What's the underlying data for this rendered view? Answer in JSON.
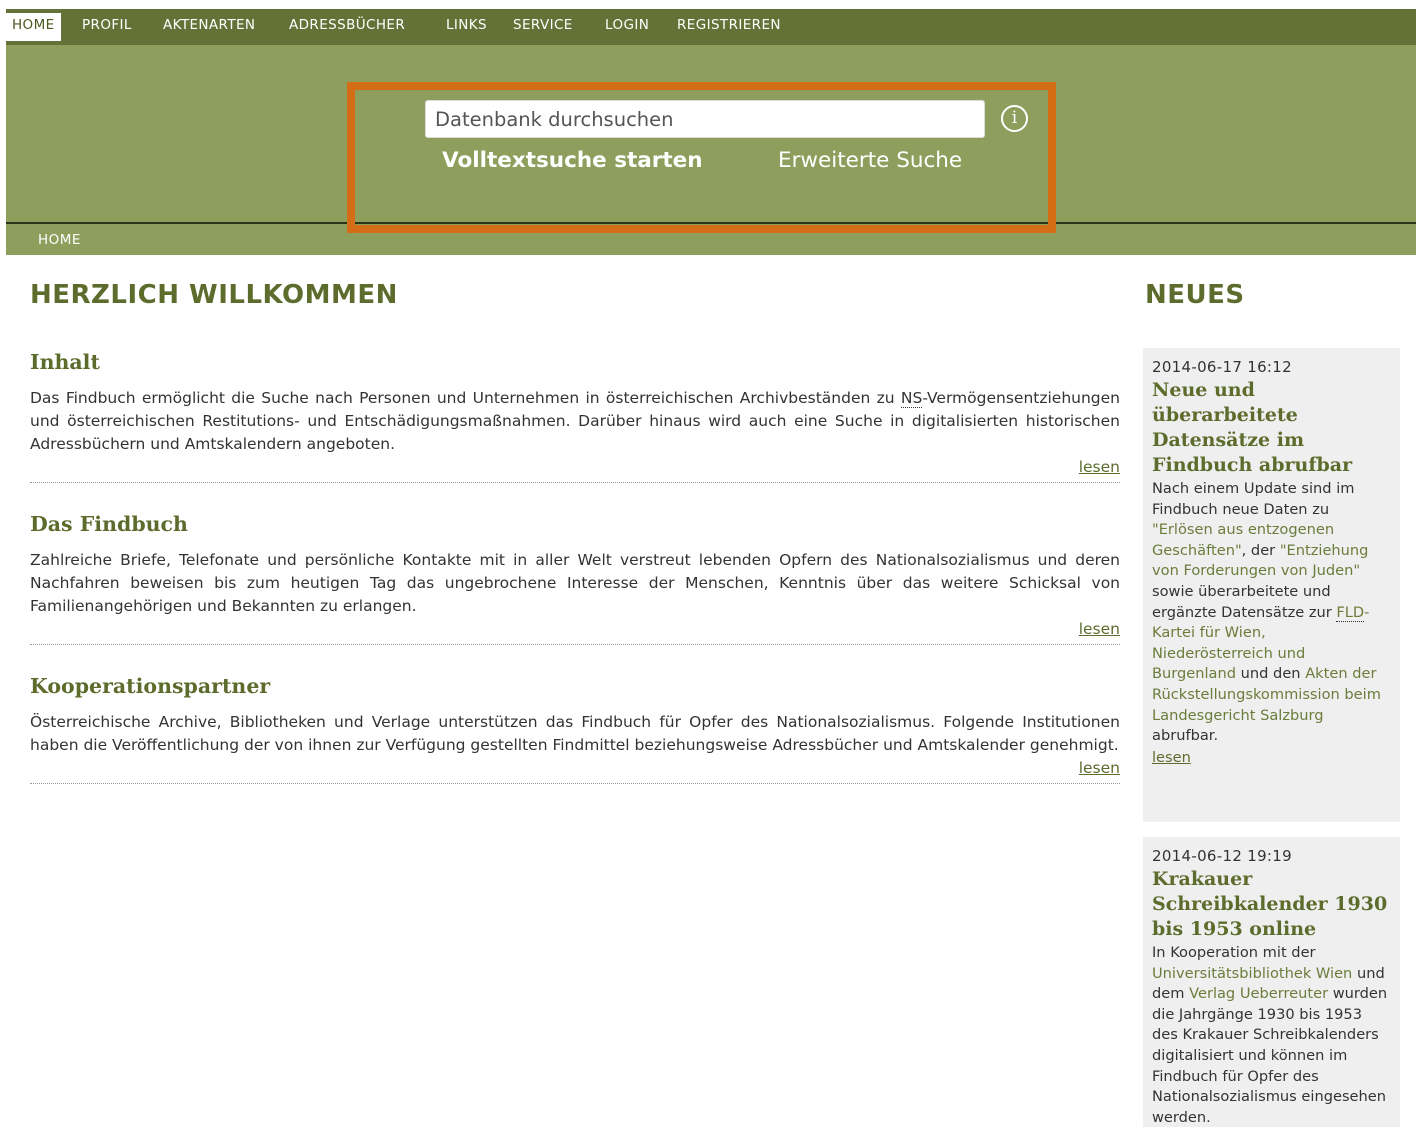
{
  "nav": {
    "items": [
      {
        "label": "HOME"
      },
      {
        "label": "PROFIL"
      },
      {
        "label": "AKTENARTEN"
      },
      {
        "label": "ADRESSBÜCHER"
      },
      {
        "label": "LINKS"
      },
      {
        "label": "SERVICE"
      },
      {
        "label": "LOGIN"
      },
      {
        "label": "REGISTRIEREN"
      }
    ]
  },
  "search": {
    "placeholder": "Datenbank durchsuchen",
    "info_icon": "info-circle-icon",
    "start_label": "Volltextsuche starten",
    "advanced_label": "Erweiterte Suche"
  },
  "breadcrumb": "HOME",
  "main": {
    "title": "HERZLICH WILLKOMMEN",
    "sections": [
      {
        "title": "Inhalt",
        "text_before": "Das Findbuch ermöglicht die Suche nach Personen und Unternehmen in österreichischen Archivbeständen zu ",
        "abbr": "NS",
        "text_after": "-Vermögensentziehungen und österreichischen Restitutions- und Entschädigungsmaßnahmen. Darüber hinaus wird auch eine Suche in digitalisierten historischen Adressbüchern und Amtskalendern angeboten.",
        "more": "lesen"
      },
      {
        "title": "Das Findbuch",
        "text": "Zahlreiche Briefe, Telefonate und persönliche Kontakte mit in aller Welt verstreut lebenden Opfern des Nationalsozialismus und deren Nachfahren beweisen bis zum heutigen Tag das ungebrochene Interesse der Menschen, Kenntnis über das weitere Schicksal von Familienangehörigen und Bekannten zu erlangen.",
        "more": "lesen"
      },
      {
        "title": "Kooperationspartner",
        "text": "Österreichische Archive, Bibliotheken und Verlage unterstützen das Findbuch für Opfer des Nationalsozialismus. Folgende Institutionen haben die Veröffentlichung der von ihnen zur Verfügung gestellten Findmittel beziehungsweise Adressbücher und Amtskalender genehmigt.",
        "more": "lesen"
      }
    ]
  },
  "sidebar": {
    "title": "NEUES",
    "news": [
      {
        "date": "2014-06-17 16:12",
        "title": "Neue und überarbeitete Datensätze im Findbuch abrufbar",
        "t1": "Nach einem Update sind im Findbuch neue Daten zu ",
        "l1": "\"Erlösen aus entzogenen Geschäften\"",
        "t2": ", der ",
        "l2": "\"Entziehung von Forderungen von Juden\"",
        "t3": " sowie überarbeitete und ergänzte Datensätze zur ",
        "abbr": "FLD",
        "l3": "-Kartei für Wien, Niederösterreich und Burgenland",
        "t4": " und den ",
        "l4": "Akten der Rückstellungskommission beim Landesgericht Salzburg",
        "t5": " abrufbar.",
        "more": "lesen"
      },
      {
        "date": "2014-06-12 19:19",
        "title": "Krakauer Schreibkalender 1930 bis 1953 online",
        "t1": "In Kooperation mit der ",
        "l1": "Universitätsbibliothek Wien",
        "t2": " und dem ",
        "l2": "Verlag Ueberreuter",
        "t3": " wurden die Jahrgänge 1930 bis 1953 des Krakauer Schreibkalenders digitalisiert und können im Findbuch für Opfer des Nationalsozialismus eingesehen werden."
      }
    ]
  },
  "colors": {
    "nav_bg": "#657237",
    "banner_bg": "#8e9f5d",
    "accent_green": "#5d6c2c",
    "highlight_border": "#d36d16",
    "news_bg": "#efefef"
  }
}
